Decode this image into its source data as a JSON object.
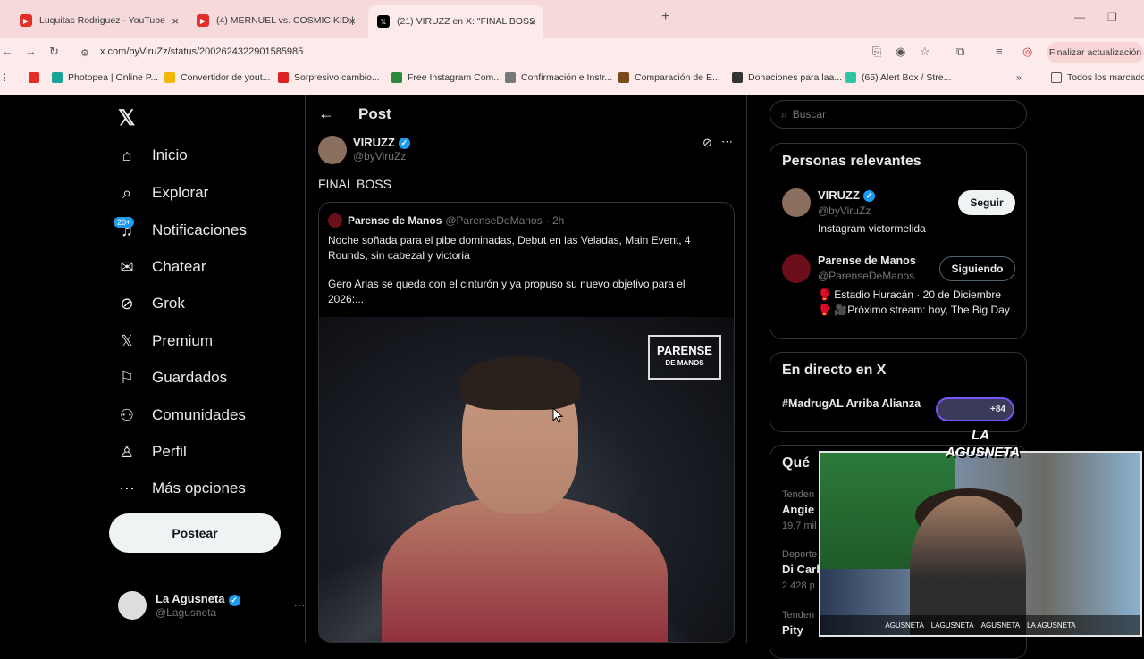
{
  "browser": {
    "tabs": [
      {
        "title": "Luquitas Rodriguez - YouTube",
        "icon": "youtube-icon"
      },
      {
        "title": "(4) MERNUEL vs. COSMIC KID |",
        "icon": "youtube-icon"
      },
      {
        "title": "(21) VIRUZZ en X: \"FINAL BOSS",
        "icon": "x-icon"
      }
    ],
    "url": "x.com/byViruZz/status/2002624322901585985",
    "update_label": "Finalizar actualización",
    "bookmarks": [
      "",
      "Photopea | Online P...",
      "Convertidor de yout...",
      "Sorpresivo cambio...",
      "Free Instagram Com...",
      "Confirmación e Instr...",
      "Comparación de E...",
      "Donaciones para laa...",
      "(65) Alert Box / Stre..."
    ],
    "all_bookmarks_label": "Todos los marcadores"
  },
  "sidebar": {
    "items": [
      {
        "label": "Inicio",
        "icon": "home-icon"
      },
      {
        "label": "Explorar",
        "icon": "search-icon"
      },
      {
        "label": "Notificaciones",
        "icon": "bell-icon"
      },
      {
        "label": "Chatear",
        "icon": "mail-icon"
      },
      {
        "label": "Grok",
        "icon": "grok-icon"
      },
      {
        "label": "Premium",
        "icon": "x-icon"
      },
      {
        "label": "Guardados",
        "icon": "bookmark-icon"
      },
      {
        "label": "Comunidades",
        "icon": "people-icon"
      },
      {
        "label": "Perfil",
        "icon": "person-icon"
      },
      {
        "label": "Más opciones",
        "icon": "more-icon"
      }
    ],
    "notifications_badge": "20+",
    "post_label": "Postear",
    "me": {
      "name": "La Agusneta",
      "handle": "@Lagusneta"
    }
  },
  "main": {
    "header_title": "Post",
    "author": {
      "name": "VIRUZZ",
      "handle": "@byViruZz"
    },
    "text": "FINAL BOSS",
    "quote": {
      "name": "Parense de Manos",
      "handle": "@ParenseDeManos",
      "time": "· 2h",
      "text1": "Noche soñada para el pibe dominadas, Debut en las Veladas, Main Event, 4 Rounds, sin cabezal y victoria",
      "text2": "Gero Arias se queda con el cinturón y ya propuso su nuevo objetivo para el 2026:...",
      "brand_line1": "PARENSE",
      "brand_line2": "DE MANOS"
    }
  },
  "right": {
    "search_placeholder": "Buscar",
    "relevant_title": "Personas relevantes",
    "people": [
      {
        "name": "VIRUZZ",
        "handle": "@byViruZz",
        "bio": "Instagram victormelida",
        "button": "Seguir"
      },
      {
        "name": "Parense de Manos",
        "handle": "@ParenseDeManos",
        "bio": "🥊 Estadio Huracán · 20 de Diciembre 🥊 🎥Próximo stream: hoy, The Big Day",
        "button": "Siguiendo"
      }
    ],
    "live_title": "En directo en X",
    "live_item": "#MadrugAL Arriba Alianza",
    "live_count": "+84",
    "whats_title": "Qué",
    "trends": [
      {
        "category": "Tenden",
        "name": "Angie",
        "count": "19,7 mil"
      },
      {
        "category": "Deporte",
        "name": "Di Carl",
        "count": "2.428 p"
      },
      {
        "category": "Tenden",
        "name": "Pity",
        "count": ""
      }
    ]
  },
  "webcam": {
    "logo_line1": "LA",
    "logo_line2": "AGUSNETA",
    "socials": [
      "AGUSNETA",
      "LAGUSNETA",
      "AGUSNETA",
      "LA AGUSNETA"
    ]
  },
  "colors": {
    "accent": "#1d9bf0",
    "background": "#000000",
    "border": "#2f3336"
  }
}
